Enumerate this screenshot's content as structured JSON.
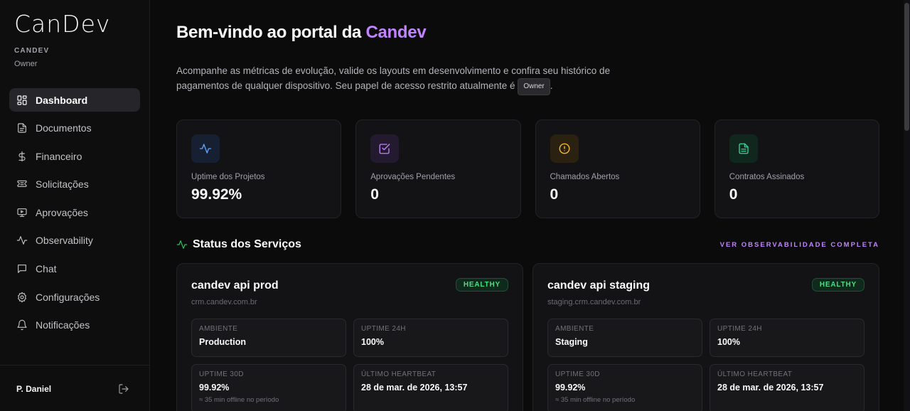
{
  "sidebar": {
    "logo": "CanDev",
    "org": "CANDEV",
    "role": "Owner",
    "items": [
      {
        "label": "Dashboard",
        "icon": "dashboard-icon"
      },
      {
        "label": "Documentos",
        "icon": "document-icon"
      },
      {
        "label": "Financeiro",
        "icon": "dollar-icon"
      },
      {
        "label": "Solicitações",
        "icon": "ticket-icon"
      },
      {
        "label": "Aprovações",
        "icon": "monitor-play-icon"
      },
      {
        "label": "Observability",
        "icon": "activity-icon"
      },
      {
        "label": "Chat",
        "icon": "chat-icon"
      },
      {
        "label": "Configurações",
        "icon": "gear-icon"
      },
      {
        "label": "Notificações",
        "icon": "bell-icon"
      }
    ],
    "user": "P. Daniel"
  },
  "header": {
    "title_prefix": "Bem-vindo ao portal da ",
    "title_brand": "Candev",
    "subtitle": "Acompanhe as métricas de evolução, valide os layouts em desenvolvimento e confira seu histórico de pagamentos de qualquer dispositivo. Seu papel de acesso restrito atualmente é ",
    "role_chip": "Owner",
    "subtitle_end": "."
  },
  "stats": [
    {
      "label": "Uptime dos Projetos",
      "value": "99.92%",
      "icon": "activity-icon",
      "color": "#60a5fa",
      "bg": "#172033"
    },
    {
      "label": "Aprovações Pendentes",
      "value": "0",
      "icon": "check-square-icon",
      "color": "#c084fc",
      "bg": "#241a30"
    },
    {
      "label": "Chamados Abertos",
      "value": "0",
      "icon": "alert-circle-icon",
      "color": "#fbbf24",
      "bg": "#2a2110"
    },
    {
      "label": "Contratos Assinados",
      "value": "0",
      "icon": "file-text-icon",
      "color": "#34d399",
      "bg": "#10271e"
    }
  ],
  "services_section": {
    "title": "Status dos Serviços",
    "see_all": "VER OBSERVABILIDADE COMPLETA"
  },
  "services": [
    {
      "name": "candev api prod",
      "host": "crm.candev.com.br",
      "status": "HEALTHY",
      "metrics": {
        "env_label": "AMBIENTE",
        "env_value": "Production",
        "uptime24_label": "UPTIME 24H",
        "uptime24_value": "100%",
        "uptime30_label": "UPTIME 30D",
        "uptime30_value": "99.92%",
        "uptime30_note": "≈ 35 min offline no período",
        "heartbeat_label": "ÚLTIMO HEARTBEAT",
        "heartbeat_value": "28 de mar. de 2026, 13:57"
      }
    },
    {
      "name": "candev api staging",
      "host": "staging.crm.candev.com.br",
      "status": "HEALTHY",
      "metrics": {
        "env_label": "AMBIENTE",
        "env_value": "Staging",
        "uptime24_label": "UPTIME 24H",
        "uptime24_value": "100%",
        "uptime30_label": "UPTIME 30D",
        "uptime30_value": "99.92%",
        "uptime30_note": "≈ 35 min offline no período",
        "heartbeat_label": "ÚLTIMO HEARTBEAT",
        "heartbeat_value": "28 de mar. de 2026, 13:57"
      }
    }
  ],
  "colors": {
    "accent": "#c084fc",
    "healthy": "#4ade80"
  }
}
